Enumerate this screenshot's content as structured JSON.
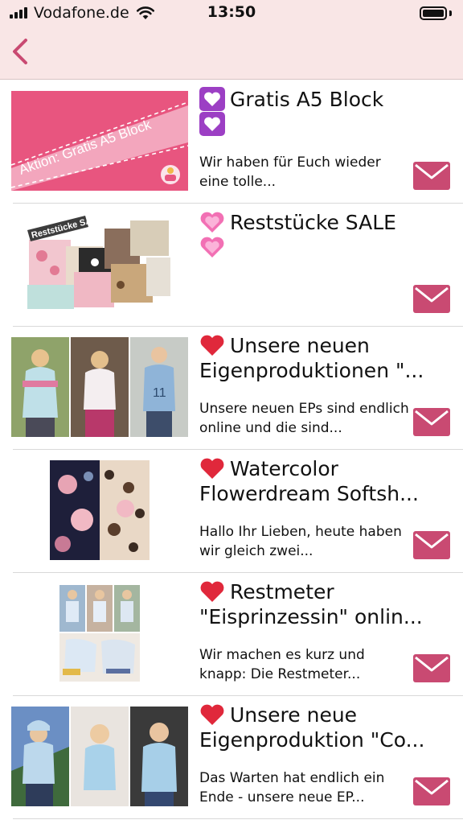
{
  "status_bar": {
    "carrier": "Vodafone.de",
    "time": "13:50",
    "signal_bars": 4,
    "battery_level": 1.0
  },
  "nav": {
    "back_icon": "chevron-left-icon"
  },
  "colors": {
    "accent": "#c94a72",
    "header_bg": "#f9e6e6",
    "divider": "#d9d9d9"
  },
  "messages": [
    {
      "emoji": "purple-heart",
      "title": "Gratis A5 Block",
      "snippet": "Wir haben für Euch wieder eine tolle...",
      "image": {
        "banner_text": "Aktion: Gratis A5 Block"
      }
    },
    {
      "emoji": "sparkling-heart",
      "title": "Reststücke SALE",
      "snippet": "",
      "image": {
        "banner_text": "Reststücke SALE"
      }
    },
    {
      "emoji": "red-heart",
      "title": "Unsere neuen Eigenproduktionen \"...",
      "snippet": "Unsere neuen EPs sind endlich online und die sind..."
    },
    {
      "emoji": "red-heart",
      "title": "Watercolor Flowerdream Softsh...",
      "snippet": "Hallo Ihr Lieben, heute haben wir gleich zwei..."
    },
    {
      "emoji": "red-heart",
      "title": "Restmeter \"Eisprinzessin\" onlin...",
      "snippet": "Wir machen es kurz und knapp: Die Restmeter..."
    },
    {
      "emoji": "red-heart",
      "title": "Unsere neue Eigenproduktion \"Co...",
      "snippet": "Das Warten hat endlich ein Ende - unsere neue EP..."
    }
  ]
}
